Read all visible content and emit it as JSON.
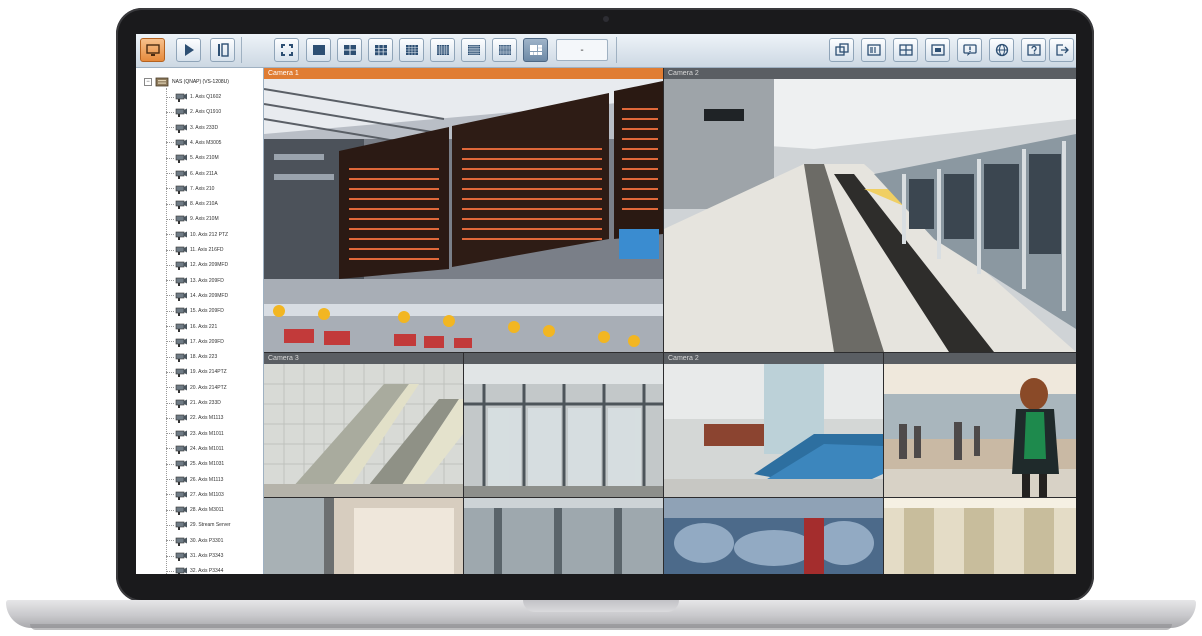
{
  "toolbar": {
    "left_icons": [
      "monitor-icon",
      "play-icon",
      "playback-icon"
    ],
    "layout_icons": [
      "fullscreen-icon",
      "layout-1x1-icon",
      "layout-2x2-icon",
      "layout-3x3-icon",
      "layout-4x4-icon",
      "layout-5x5-icon",
      "layout-6x6-icon",
      "layout-8x8-icon",
      "layout-custom-icon"
    ],
    "select_value": "-",
    "right_icons": [
      "windows-icon",
      "list-icon",
      "grid-icon",
      "snapshot-icon",
      "alert-icon",
      "globe-icon",
      "help-icon",
      "logout-icon"
    ]
  },
  "sidebar": {
    "root_label": "NAS (QNAP) (VS-1208U)",
    "items": [
      {
        "label": "1. Axis Q1602"
      },
      {
        "label": "2. Axis Q1910"
      },
      {
        "label": "3. Axis 233D"
      },
      {
        "label": "4. Axis M3005"
      },
      {
        "label": "5. Axis 210M"
      },
      {
        "label": "6. Axis 211A"
      },
      {
        "label": "7. Axis 210"
      },
      {
        "label": "8. Axis 210A"
      },
      {
        "label": "9. Axis 210M"
      },
      {
        "label": "10. Axis 212 PTZ"
      },
      {
        "label": "11. Axis 216FD"
      },
      {
        "label": "12. Axis 209MFD"
      },
      {
        "label": "13. Axis 209FD"
      },
      {
        "label": "14. Axis 209MFD"
      },
      {
        "label": "15. Axis 209FD"
      },
      {
        "label": "16. Axis 221"
      },
      {
        "label": "17. Axis 209FD"
      },
      {
        "label": "18. Axis 223"
      },
      {
        "label": "19. Axis 214PTZ"
      },
      {
        "label": "20. Axis 214PTZ"
      },
      {
        "label": "21. Axis 233D"
      },
      {
        "label": "22. Axis M1113"
      },
      {
        "label": "23. Axis M1011"
      },
      {
        "label": "24. Axis M1011"
      },
      {
        "label": "25. Axis M1031"
      },
      {
        "label": "26. Axis M1113"
      },
      {
        "label": "27. Axis M1103"
      },
      {
        "label": "28. Axis M3011"
      },
      {
        "label": "29. Stream Server"
      },
      {
        "label": "30. Axis P3301"
      },
      {
        "label": "31. Axis P3343"
      },
      {
        "label": "32. Axis P3344"
      }
    ]
  },
  "cameras": [
    {
      "label": "Camera 1",
      "scene": "airport-departure-board"
    },
    {
      "label": "Camera 2",
      "scene": "subway-platform"
    },
    {
      "label": "Camera 3",
      "scene": "escalator"
    },
    {
      "label": "",
      "scene": "glass-doors"
    },
    {
      "label": "Camera 2",
      "scene": "waiting-seats"
    },
    {
      "label": "",
      "scene": "walking-woman"
    },
    {
      "label": "",
      "scene": "doorway"
    },
    {
      "label": "",
      "scene": "corridor"
    },
    {
      "label": "",
      "scene": "motion-blur-crowd"
    },
    {
      "label": "",
      "scene": "lobby"
    }
  ],
  "colors": {
    "active_tile": "#e07d33",
    "toolbar_active": "#e68a3c",
    "toolbar_selected": "#6d89a6"
  }
}
